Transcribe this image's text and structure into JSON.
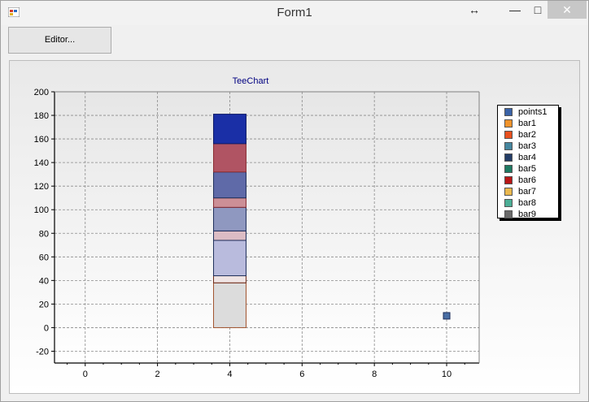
{
  "window": {
    "title": "Form1",
    "resize_glyph": "↔",
    "minimize_glyph": "—",
    "maximize_glyph": "□",
    "close_glyph": "✕"
  },
  "toolbar": {
    "editor_label": "Editor..."
  },
  "colors": {
    "points1": "#4a6fa5",
    "grid": "#8a8a8a",
    "title": "#000080"
  },
  "legend": {
    "items": [
      {
        "name": "points1",
        "color": "#3a62a7"
      },
      {
        "name": "bar1",
        "color": "#f0932b"
      },
      {
        "name": "bar2",
        "color": "#e8501e"
      },
      {
        "name": "bar3",
        "color": "#45869f"
      },
      {
        "name": "bar4",
        "color": "#233d66"
      },
      {
        "name": "bar5",
        "color": "#1e7a62"
      },
      {
        "name": "bar6",
        "color": "#b81616"
      },
      {
        "name": "bar7",
        "color": "#eab84e"
      },
      {
        "name": "bar8",
        "color": "#4cae96"
      },
      {
        "name": "bar9",
        "color": "#6b6b6b"
      }
    ]
  },
  "chart_data": {
    "type": "bar",
    "title": "TeeChart",
    "xlabel": "",
    "ylabel": "",
    "xlim": [
      -0.85,
      10.9
    ],
    "ylim": [
      -30,
      200
    ],
    "x_ticks": [
      0,
      2,
      4,
      6,
      8,
      10
    ],
    "y_ticks": [
      -20,
      0,
      20,
      40,
      60,
      80,
      100,
      120,
      140,
      160,
      180,
      200
    ],
    "grid": true,
    "legend_position": "right",
    "stacked_bar": {
      "x": 4,
      "segments": [
        {
          "from": 0,
          "to": 38,
          "fill": "#dcdcdc",
          "stroke": "#a0522d"
        },
        {
          "from": 38,
          "to": 44,
          "fill": "#efe4e4",
          "stroke": "#6b2a1a"
        },
        {
          "from": 44,
          "to": 74,
          "fill": "#b9bbdd",
          "stroke": "#1e2e5a"
        },
        {
          "from": 74,
          "to": 82,
          "fill": "#dcbcc4",
          "stroke": "#1e2e5a"
        },
        {
          "from": 82,
          "to": 102,
          "fill": "#8f98c0",
          "stroke": "#1e2e5a"
        },
        {
          "from": 102,
          "to": 110,
          "fill": "#cc8f96",
          "stroke": "#8a2e33"
        },
        {
          "from": 110,
          "to": 132,
          "fill": "#5f6aa8",
          "stroke": "#1e2e5a"
        },
        {
          "from": 132,
          "to": 156,
          "fill": "#b05463",
          "stroke": "#8a2e33"
        },
        {
          "from": 156,
          "to": 181,
          "fill": "#1a2fa6",
          "stroke": "#0d1a66"
        }
      ]
    },
    "points": [
      {
        "x": 10,
        "y": 10
      }
    ]
  }
}
